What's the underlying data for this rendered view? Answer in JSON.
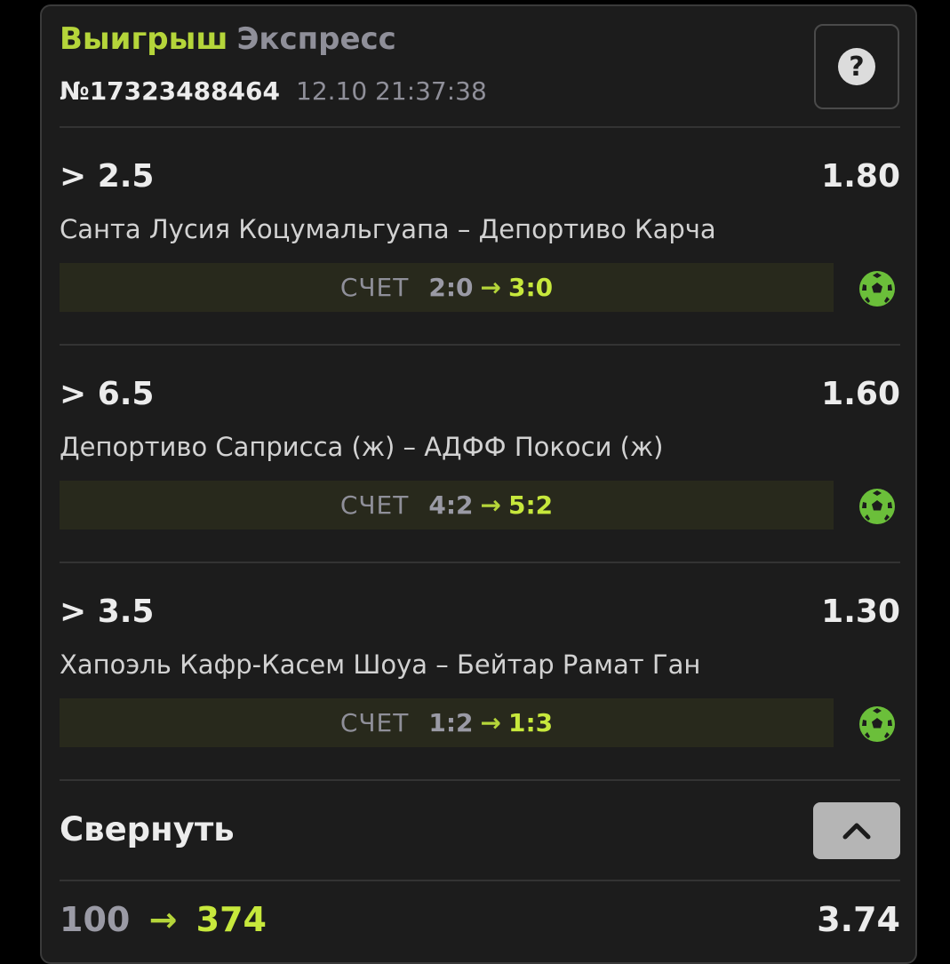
{
  "header": {
    "status": "Выигрыш",
    "type": "Экспресс",
    "bet_number": "№17323488464",
    "datetime": "12.10 21:37:38",
    "help_icon": "question-icon"
  },
  "score_label": "СЧЕТ",
  "arrow": "→",
  "events": [
    {
      "market": "> 2.5",
      "odds": "1.80",
      "teams": "Санта Лусия Коцумальгуапа – Депортиво Карча",
      "score_from": "2:0",
      "score_to": "3:0",
      "sport_icon": "soccer-ball-icon"
    },
    {
      "market": "> 6.5",
      "odds": "1.60",
      "teams": "Депортиво Саприсса (ж) – АДФФ Покоси (ж)",
      "score_from": "4:2",
      "score_to": "5:2",
      "sport_icon": "soccer-ball-icon"
    },
    {
      "market": "> 3.5",
      "odds": "1.30",
      "teams": "Хапоэль Кафр-Касем Шоуа – Бейтар Рамат Ган",
      "score_from": "1:2",
      "score_to": "1:3",
      "sport_icon": "soccer-ball-icon"
    }
  ],
  "collapse": {
    "label": "Свернуть",
    "icon": "chevron-up-icon"
  },
  "footer": {
    "stake": "100",
    "payout": "374",
    "total_odds": "3.74"
  },
  "colors": {
    "accent": "#b5d53a",
    "background": "#1c1c1c",
    "score_bar": "#28291c"
  }
}
